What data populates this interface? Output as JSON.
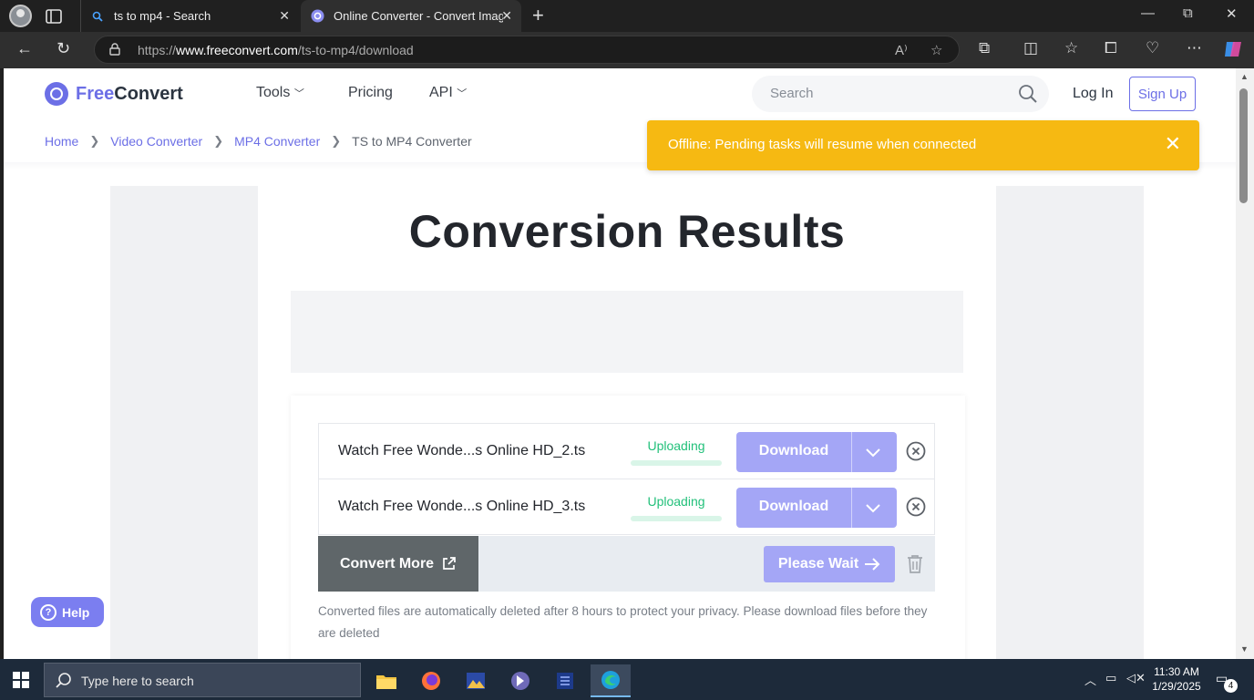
{
  "browser": {
    "tabs": [
      {
        "title": "ts to mp4 - Search",
        "close": "✕"
      },
      {
        "title": "Online Converter - Convert Image",
        "close": "✕"
      }
    ],
    "new_tab": "+",
    "window_controls": {
      "minimize": "—",
      "maximize": "⧉",
      "close": "✕"
    },
    "url_prefix": "https://",
    "url_host": "www.freeconvert.com",
    "url_path": "/ts-to-mp4/download"
  },
  "site": {
    "logo_free": "Free",
    "logo_convert": "Convert",
    "nav": {
      "tools": "Tools",
      "pricing": "Pricing",
      "api": "API"
    },
    "search_placeholder": "Search",
    "login": "Log In",
    "signup": "Sign Up",
    "breadcrumbs": [
      "Home",
      "Video Converter",
      "MP4 Converter",
      "TS to MP4 Converter"
    ],
    "toast": "Offline: Pending tasks will resume when connected",
    "heading": "Conversion Results",
    "files": [
      {
        "name": "Watch Free Wonde...s Online HD_2.ts",
        "status": "Uploading",
        "download": "Download"
      },
      {
        "name": "Watch Free Wonde...s Online HD_3.ts",
        "status": "Uploading",
        "download": "Download"
      }
    ],
    "convert_more": "Convert More",
    "please_wait": "Please Wait",
    "note": "Converted files are automatically deleted after 8 hours to protect your privacy. Please download files before they are deleted",
    "help": "Help"
  },
  "taskbar": {
    "search_placeholder": "Type here to search",
    "time": "11:30 AM",
    "date": "1/29/2025",
    "notification_count": "4"
  },
  "colors": {
    "accent": "#6c6fe6",
    "toast": "#f6b912",
    "uploading": "#22c07a",
    "button_disabled": "#a4a6f6"
  }
}
